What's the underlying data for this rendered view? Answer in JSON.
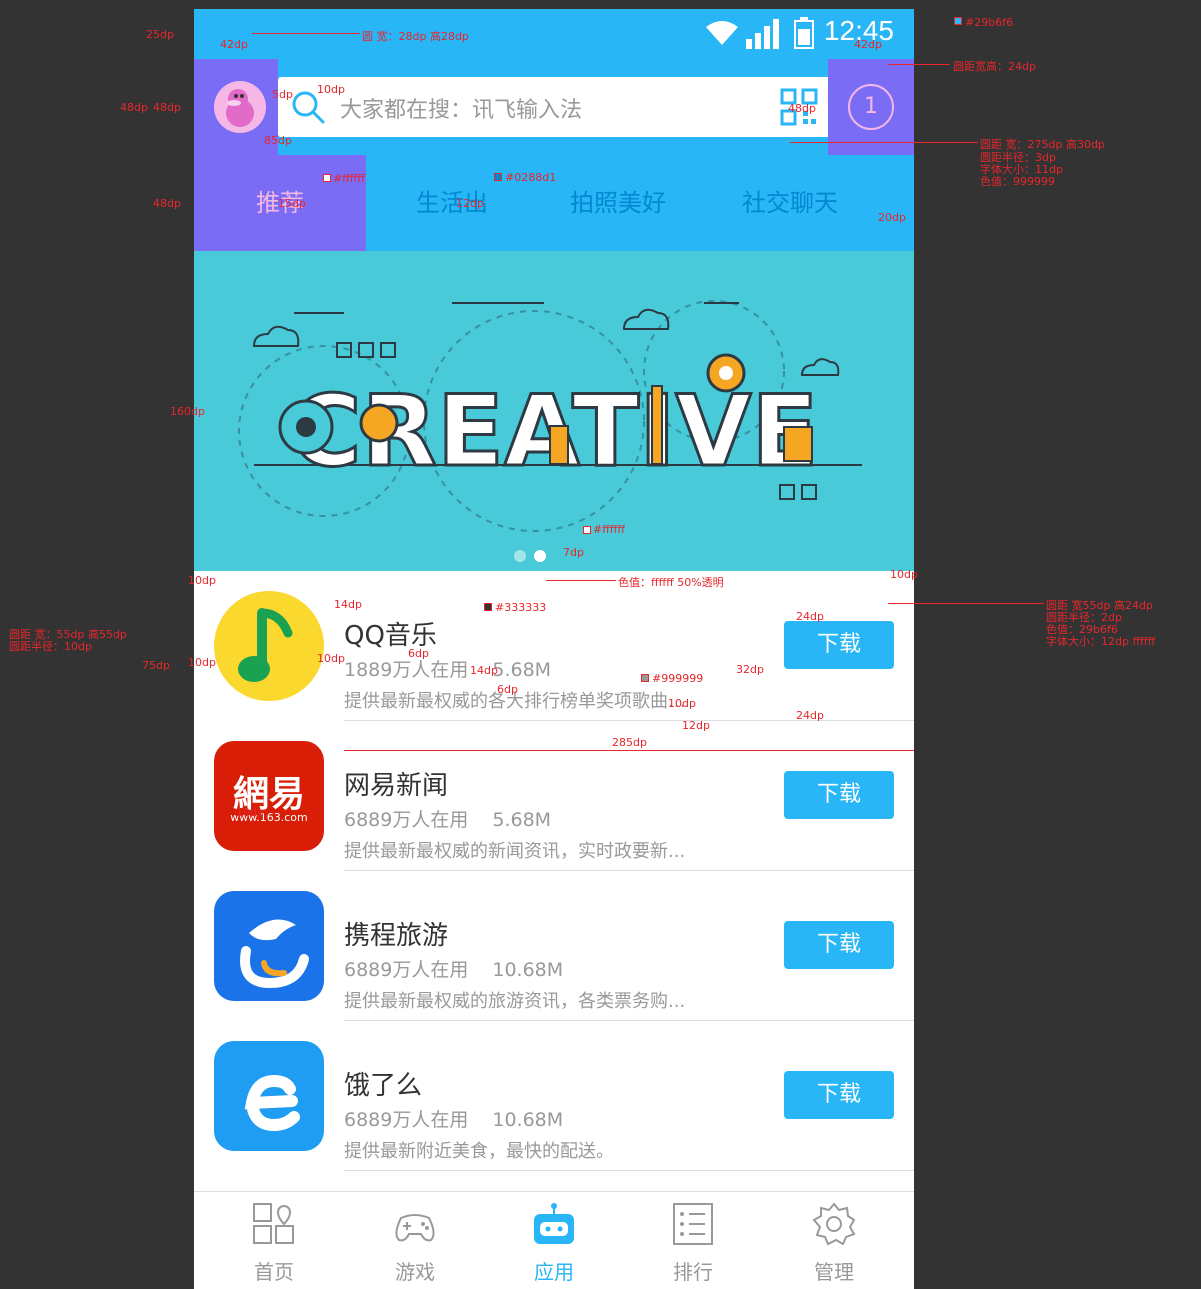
{
  "status": {
    "time": "12:45"
  },
  "header": {
    "search_placeholder": "大家都在搜：讯飞输入法",
    "message_count": "1"
  },
  "tabs": [
    {
      "label": "推荐",
      "active": true
    },
    {
      "label": "生活出",
      "active": false
    },
    {
      "label": "拍照美好",
      "active": false
    },
    {
      "label": "社交聊天",
      "active": false
    }
  ],
  "banner": {
    "word": "CREATIVE"
  },
  "apps": [
    {
      "name": "QQ音乐",
      "users": "1889万人在用",
      "size": "5.68M",
      "desc": "提供最新最权威的各大排行榜单奖项歌曲...",
      "button": "下载",
      "icon": "qq-music-icon"
    },
    {
      "name": "网易新闻",
      "users": "6889万人在用",
      "size": "5.68M",
      "desc": "提供最新最权威的新闻资讯，实时政要新...",
      "button": "下载",
      "icon": "netease-icon"
    },
    {
      "name": "携程旅游",
      "users": "6889万人在用",
      "size": "10.68M",
      "desc": "提供最新最权威的旅游资讯，各类票务购...",
      "button": "下载",
      "icon": "ctrip-icon"
    },
    {
      "name": "饿了么",
      "users": "6889万人在用",
      "size": "10.68M",
      "desc": "提供最新附近美食，最快的配送。",
      "button": "下载",
      "icon": "eleme-icon"
    }
  ],
  "netease_icon_text": {
    "main": "網易",
    "sub": "www.163.com"
  },
  "bottom_nav": [
    {
      "label": "首页",
      "icon": "home-grid-icon",
      "active": false
    },
    {
      "label": "游戏",
      "icon": "gamepad-icon",
      "active": false
    },
    {
      "label": "应用",
      "icon": "robot-icon",
      "active": true
    },
    {
      "label": "排行",
      "icon": "ranking-list-icon",
      "active": false
    },
    {
      "label": "管理",
      "icon": "gear-icon",
      "active": false
    }
  ],
  "colors": {
    "primary": "#29b6f6",
    "tab_text": "#0288d1",
    "title_text": "#333333",
    "sub_text": "#999999",
    "highlight": "#7b6cf6",
    "banner": "#48cad9"
  },
  "annotations": {
    "avatar_note": "圆 宽：28dp 高28dp",
    "statusbar_color": "#29b6f6",
    "msg_note": "圆距宽高：24dp",
    "search_note_1": "圆距 宽：275dp 高30dp",
    "search_note_2": "圆距半径：3dp",
    "search_note_3": "字体大小：11dp",
    "search_note_4": "色值：999999",
    "tab_active_color": "#ffffff",
    "tab_color": "#0288d1",
    "dot_color": "#ffffff",
    "dot_note": "色值：ffffff 50%透明",
    "title_color": "#333333",
    "meta_color": "#999999",
    "icon_note_1": "圆距 宽：55dp 高55dp",
    "icon_note_2": "圆距半径：10dp",
    "btn_note_1": "圆距 宽55dp 高24dp",
    "btn_note_2": "圆距半径：2dp",
    "btn_note_3": "色值：29b6f6",
    "btn_note_4": "字体大小：12dp    ffffff",
    "d25": "25dp",
    "d42a": "42dp",
    "d42b": "42dp",
    "d48a": "48dp",
    "d48b": "48dp",
    "d48c": "48dp",
    "d48d": "48dp",
    "d5": "5dp",
    "d10a": "10dp",
    "d85": "85dp",
    "d15": "15dp",
    "d12a": "12dp",
    "d20": "20dp",
    "d160": "160dp",
    "d7": "7dp",
    "d10b": "10dp",
    "d10c": "10dp",
    "d14a": "14dp",
    "d75": "75dp",
    "d10d": "10dp",
    "d10e": "10dp",
    "d6a": "6dp",
    "d14b": "14dp",
    "d6b": "6dp",
    "d32": "32dp",
    "d24a": "24dp",
    "d24b": "24dp",
    "d10f": "10dp",
    "d12b": "12dp",
    "d285": "285dp",
    "d10g": "10dp"
  }
}
